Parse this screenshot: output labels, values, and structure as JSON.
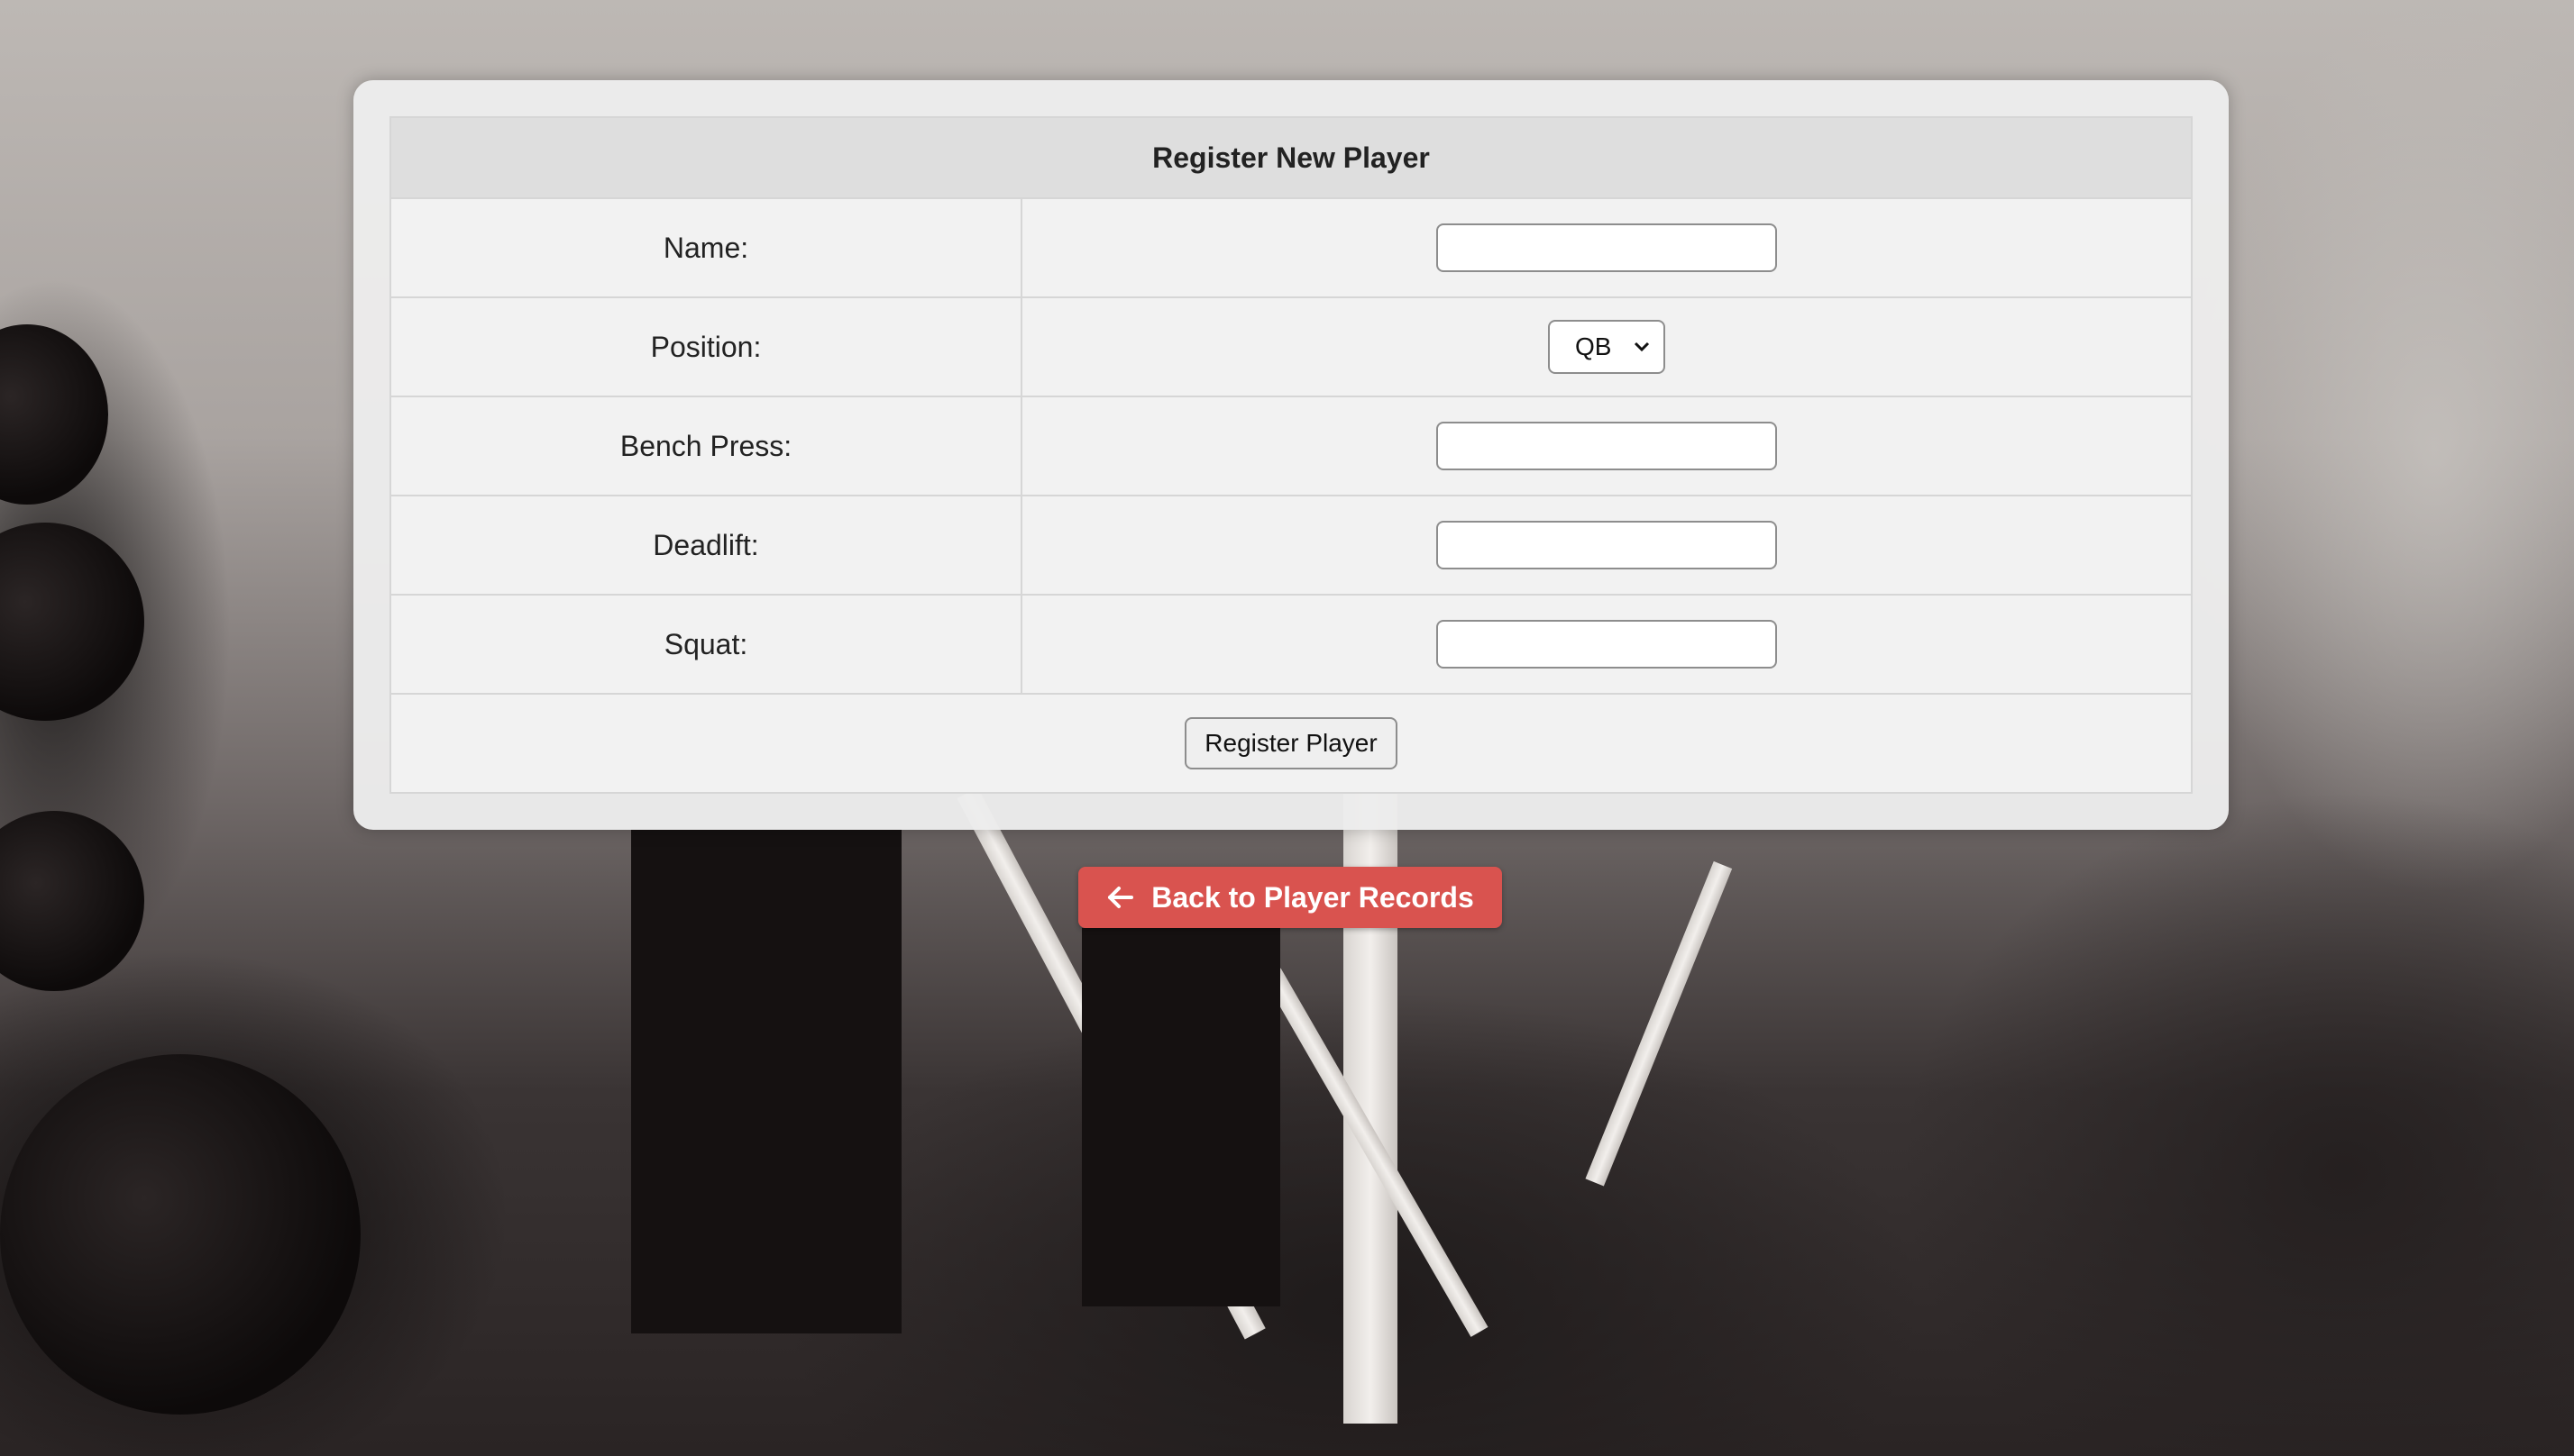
{
  "form": {
    "title": "Register New Player",
    "fields": [
      {
        "label": "Name:",
        "value": ""
      },
      {
        "label": "Position:",
        "value": "QB"
      },
      {
        "label": "Bench Press:",
        "value": ""
      },
      {
        "label": "Deadlift:",
        "value": ""
      },
      {
        "label": "Squat:",
        "value": ""
      }
    ],
    "submit_label": "Register Player"
  },
  "back_link": {
    "label": "Back to Player Records",
    "icon": "arrow-left-icon",
    "color": "#d9534f"
  },
  "background": {
    "description_icon": "gym-photo"
  }
}
